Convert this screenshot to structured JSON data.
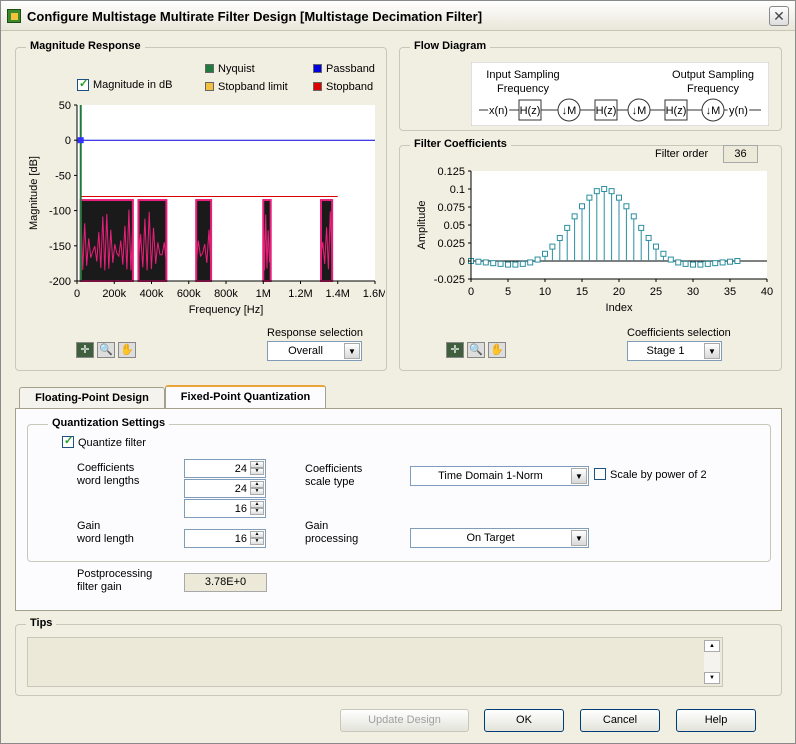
{
  "window": {
    "title": "Configure Multistage Multirate Filter Design [Multistage Decimation Filter]"
  },
  "magnitude": {
    "group_title": "Magnitude Response",
    "db_checkbox_label": "Magnitude in dB",
    "db_checked": true,
    "legend": [
      {
        "label": "Nyquist",
        "color": "#1f7a3e"
      },
      {
        "label": "Passband",
        "color": "#0000dd"
      },
      {
        "label": "Stopband limit",
        "color": "#f0c040"
      },
      {
        "label": "Stopband",
        "color": "#dd0000"
      }
    ],
    "response_selection_label": "Response selection",
    "response_selection_value": "Overall"
  },
  "flow": {
    "group_title": "Flow Diagram",
    "input_label": "Input Sampling\nFrequency",
    "output_label": "Output Sampling\nFrequency",
    "input_line1": "Input Sampling",
    "input_line2": "Frequency",
    "output_line1": "Output Sampling",
    "output_line2": "Frequency",
    "x_label": "x(n)",
    "y_label": "y(n)",
    "filter_label": "H(z)",
    "decimator_label": "↓M"
  },
  "coefficients": {
    "group_title": "Filter Coefficients",
    "filter_order_label": "Filter order",
    "filter_order_value": "36",
    "selection_label": "Coefficients selection",
    "selection_value": "Stage 1"
  },
  "tabs": [
    {
      "label": "Floating-Point Design",
      "active": false
    },
    {
      "label": "Fixed-Point Quantization",
      "active": true
    }
  ],
  "quantization": {
    "group_title": "Quantization Settings",
    "quantize_label": "Quantize filter",
    "quantize_checked": true,
    "coef_wl_label_1": "Coefficients",
    "coef_wl_label_2": "word lengths",
    "coef_wl_values": [
      "24",
      "24",
      "16"
    ],
    "gain_wl_label_1": "Gain",
    "gain_wl_label_2": "word length",
    "gain_wl_value": "16",
    "scale_type_label_1": "Coefficients",
    "scale_type_label_2": "scale type",
    "scale_type_value": "Time Domain 1-Norm",
    "scale_pow2_label": "Scale by power of 2",
    "gain_proc_label_1": "Gain",
    "gain_proc_label_2": "processing",
    "gain_proc_value": "On Target",
    "post_gain_label_1": "Postprocessing",
    "post_gain_label_2": "filter gain",
    "post_gain_value": "3.78E+0"
  },
  "tips": {
    "group_title": "Tips"
  },
  "buttons": {
    "update": "Update Design",
    "ok": "OK",
    "cancel": "Cancel",
    "help": "Help"
  },
  "chart_data": [
    {
      "type": "line",
      "title": "",
      "xlabel": "Frequency [Hz]",
      "ylabel": "Magnitude [dB]",
      "xlim": [
        0,
        1600000
      ],
      "ylim": [
        -200,
        50
      ],
      "x_ticks": [
        "0",
        "200k",
        "400k",
        "600k",
        "800k",
        "1M",
        "1.2M",
        "1.4M",
        "1.6M"
      ],
      "y_ticks": [
        "50",
        "0",
        "-50",
        "-100",
        "-150",
        "-200"
      ],
      "series": [
        {
          "name": "Passband",
          "y": 0,
          "x_range": [
            0,
            1600000
          ]
        },
        {
          "name": "Stopband",
          "y": -80,
          "x_range": [
            20000,
            1400000
          ]
        },
        {
          "name": "Nyquist",
          "x": 20000
        }
      ],
      "stopband_lobes_hz": [
        [
          20000,
          300000
        ],
        [
          330000,
          480000
        ],
        [
          640000,
          720000
        ],
        [
          1000000,
          1040000
        ],
        [
          1310000,
          1370000
        ]
      ]
    },
    {
      "type": "scatter",
      "title": "",
      "xlabel": "Index",
      "ylabel": "Amplitude",
      "xlim": [
        0,
        40
      ],
      "ylim": [
        -0.025,
        0.125
      ],
      "x_ticks": [
        "0",
        "5",
        "10",
        "15",
        "20",
        "25",
        "30",
        "35",
        "40"
      ],
      "y_ticks": [
        "0.125",
        "0.1",
        "0.075",
        "0.05",
        "0.025",
        "0",
        "-0.025"
      ],
      "x": [
        0,
        1,
        2,
        3,
        4,
        5,
        6,
        7,
        8,
        9,
        10,
        11,
        12,
        13,
        14,
        15,
        16,
        17,
        18,
        19,
        20,
        21,
        22,
        23,
        24,
        25,
        26,
        27,
        28,
        29,
        30,
        31,
        32,
        33,
        34,
        35,
        36
      ],
      "values": [
        0.0,
        -0.001,
        -0.002,
        -0.003,
        -0.004,
        -0.005,
        -0.005,
        -0.004,
        -0.002,
        0.002,
        0.01,
        0.02,
        0.032,
        0.046,
        0.062,
        0.076,
        0.088,
        0.097,
        0.1,
        0.097,
        0.088,
        0.076,
        0.062,
        0.046,
        0.032,
        0.02,
        0.01,
        0.002,
        -0.002,
        -0.004,
        -0.005,
        -0.005,
        -0.004,
        -0.003,
        -0.002,
        -0.001,
        0.0
      ]
    }
  ]
}
